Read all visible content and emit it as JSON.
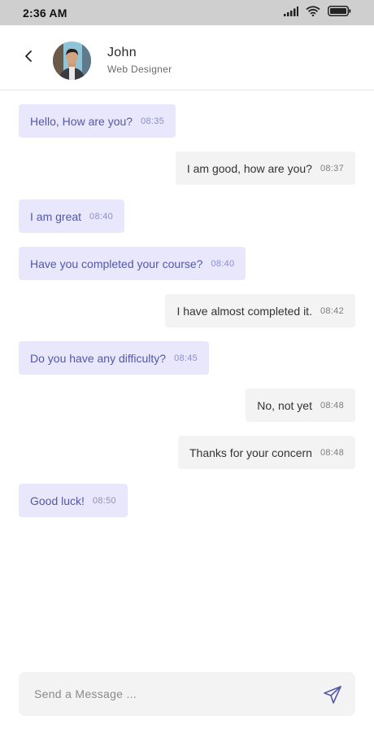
{
  "status_bar": {
    "time": "2:36 AM",
    "icons": [
      "signal-icon",
      "wifi-icon",
      "battery-icon"
    ]
  },
  "header": {
    "back_icon": "chevron-left-icon",
    "contact": {
      "name": "John",
      "role": "Web Designer"
    }
  },
  "messages": [
    {
      "direction": "in",
      "text": "Hello, How are you?",
      "time": "08:35"
    },
    {
      "direction": "out",
      "text": "I am good, how are you?",
      "time": "08:37"
    },
    {
      "direction": "in",
      "text": "I am great",
      "time": "08:40"
    },
    {
      "direction": "in",
      "text": "Have you completed your course?",
      "time": "08:40"
    },
    {
      "direction": "out",
      "text": "I have almost completed it.",
      "time": "08:42"
    },
    {
      "direction": "in",
      "text": "Do you have any difficulty?",
      "time": "08:45"
    },
    {
      "direction": "out",
      "text": "No, not yet",
      "time": "08:48"
    },
    {
      "direction": "out",
      "text": "Thanks for your concern",
      "time": "08:48"
    },
    {
      "direction": "in",
      "text": "Good luck!",
      "time": "08:50"
    }
  ],
  "composer": {
    "placeholder": "Send a Message ...",
    "value": "",
    "send_icon": "send-icon"
  },
  "colors": {
    "incoming_bg": "#e8e7fb",
    "incoming_text": "#5458a6",
    "outgoing_bg": "#f3f3f3",
    "accent": "#5458a6"
  }
}
